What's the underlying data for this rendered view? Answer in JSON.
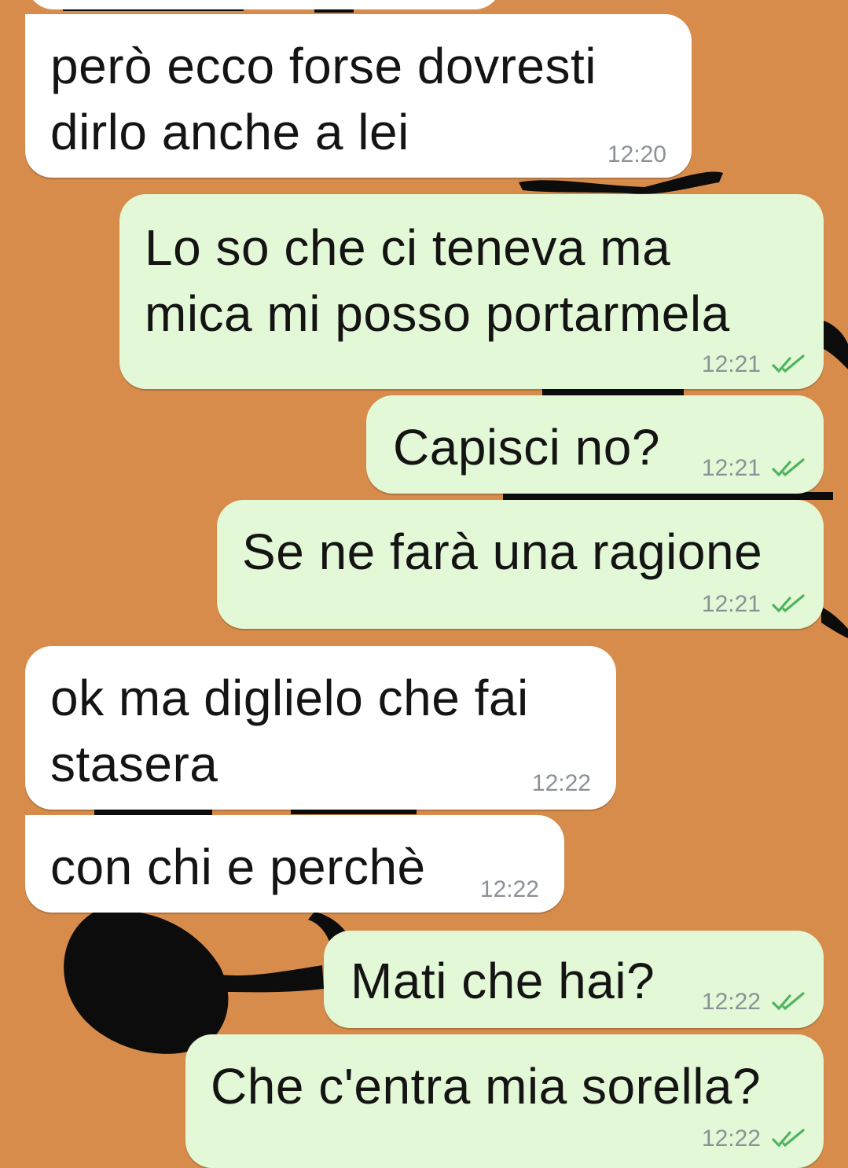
{
  "messages": [
    {
      "text": "però ecco forse dovresti\ndirlo anche a lei",
      "time": "12:20",
      "direction": "in"
    },
    {
      "text": "Lo so che ci teneva ma\nmica mi posso portarmela",
      "time": "12:21",
      "direction": "out",
      "status": "read-double-check-icon"
    },
    {
      "text": "Capisci no?",
      "time": "12:21",
      "direction": "out",
      "status": "read-double-check-icon"
    },
    {
      "text": "Se ne farà una ragione",
      "time": "12:21",
      "direction": "out",
      "status": "read-double-check-icon"
    },
    {
      "text": "ok ma diglielo che fai\nstasera",
      "time": "12:22",
      "direction": "in"
    },
    {
      "text": "con chi e perchè",
      "time": "12:22",
      "direction": "in"
    },
    {
      "text": "Mati che hai?",
      "time": "12:22",
      "direction": "out",
      "status": "read-double-check-icon"
    },
    {
      "text": "Che c'entra mia sorella?",
      "time": "12:22",
      "direction": "out",
      "status": "read-double-check-icon"
    }
  ],
  "colors": {
    "wallpaper": "#D78C4B",
    "incoming_bubble": "#FFFFFF",
    "outgoing_bubble": "#E3F8D6",
    "read_ticks": "#4FB45E",
    "timestamp": "#8B9196"
  }
}
